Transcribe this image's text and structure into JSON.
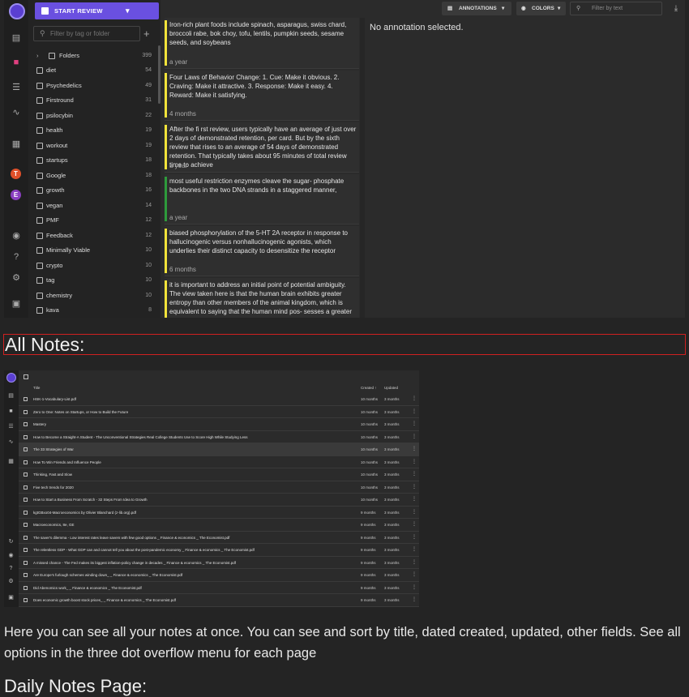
{
  "toolbar": {
    "start_review": "START REVIEW",
    "annotations": "ANNOTATIONS",
    "colors": "COLORS",
    "filter_placeholder": "Filter by text"
  },
  "tag_panel": {
    "filter_placeholder": "Filter by tag or folder",
    "folders": {
      "label": "Folders",
      "count": "399"
    },
    "tags": [
      {
        "label": "diet",
        "count": "54"
      },
      {
        "label": "Psychedelics",
        "count": "49"
      },
      {
        "label": "Firstround",
        "count": "31"
      },
      {
        "label": "psilocybin",
        "count": "22"
      },
      {
        "label": "health",
        "count": "19"
      },
      {
        "label": "workout",
        "count": "19"
      },
      {
        "label": "startups",
        "count": "18"
      },
      {
        "label": "Google",
        "count": "18"
      },
      {
        "label": "growth",
        "count": "16"
      },
      {
        "label": "vegan",
        "count": "14"
      },
      {
        "label": "PMF",
        "count": "12"
      },
      {
        "label": "Feedback",
        "count": "12"
      },
      {
        "label": "Minimally Viable",
        "count": "10"
      },
      {
        "label": "crypto",
        "count": "10"
      },
      {
        "label": "tag",
        "count": "10"
      },
      {
        "label": "chemistry",
        "count": "10"
      },
      {
        "label": "kava",
        "count": "8"
      }
    ]
  },
  "rail_avatars": [
    "T",
    "E"
  ],
  "annotations": [
    {
      "text": "Iron-rich plant foods include spinach, asparagus, swiss chard, broccoli rabe, bok choy, tofu, lentils, pumpkin seeds, sesame seeds, and soybeans",
      "age": "a year",
      "color": "#f2e33a"
    },
    {
      "text": "Four Laws of Behavior Change: 1. Cue: Make it obvious. 2. Craving: Make it attractive. 3. Response: Make it easy. 4. Reward: Make it satisfying.",
      "age": "4 months",
      "color": "#f2e33a"
    },
    {
      "text": "After the fi rst review, users typically have an average of just over 2 days of demonstrated retention, per card. But by the sixth review that rises to an average of 54 days of demonstrated retention. That typically takes about 95 minutes of total review time to achieve",
      "age": "a year",
      "color": "#f2e33a"
    },
    {
      "text": "most useful restriction enzymes cleave the sugar- phosphate backbones in the two DNA strands in a staggered manner,",
      "age": "a year",
      "color": "#2e9b3c"
    },
    {
      "text": "biased phosphorylation of the 5-HT 2A receptor in response to hallucinogenic versus nonhallucinogenic agonists, which underlies their distinct capacity to desensitize the receptor",
      "age": "6 months",
      "color": "#f2e33a"
    },
    {
      "text": "it is important to address an initial point of potential ambiguity. The view taken here is that the human brain exhibits greater entropy than other members of the animal kingdom, which is equivalent to saying that the human mind pos- sesses a greater repertoire of",
      "age": "",
      "color": "#f2e33a"
    }
  ],
  "detail": {
    "empty": "No annotation selected."
  },
  "section_heading": "All Notes:",
  "notes_table": {
    "columns": {
      "title": "Title",
      "created": "Created",
      "updated": "Updated"
    },
    "rows": [
      {
        "title": "HSK-1-Vocabulary-List.pdf",
        "created": "10 months",
        "updated": "3 months"
      },
      {
        "title": "Zero to One: Notes on Startups, or How to Build the Future",
        "created": "10 months",
        "updated": "3 months"
      },
      {
        "title": "Mastery",
        "created": "10 months",
        "updated": "3 months"
      },
      {
        "title": "How to Become a Straight-A Student - The Unconventional Strategies Real College Students Use to Score High While Studying Less",
        "created": "10 months",
        "updated": "3 months"
      },
      {
        "title": "The 33 Strategies of War",
        "created": "10 months",
        "updated": "3 months"
      },
      {
        "title": "How To Win Friends and Influence People",
        "created": "10 months",
        "updated": "3 months"
      },
      {
        "title": "Thinking, Fast and Slow",
        "created": "10 months",
        "updated": "3 months"
      },
      {
        "title": "Five tech trends for 2020",
        "created": "10 months",
        "updated": "3 months"
      },
      {
        "title": "How to Start a Business From Scratch - 32 Steps From Idea to Growth",
        "created": "10 months",
        "updated": "3 months"
      },
      {
        "title": "kgtGBxo04-Macroeconomics by Olivier Blanchard (z-lib.org).pdf",
        "created": "9 months",
        "updated": "3 months"
      },
      {
        "title": "Macroeconomics, 8e, GE",
        "created": "9 months",
        "updated": "3 months"
      },
      {
        "title": "The saver's dilemma - Low interest rates leave savers with few good options _ Finance & economics _ The Economist.pdf",
        "created": "9 months",
        "updated": "3 months"
      },
      {
        "title": "The relentless GDP - What GDP can and cannot tell you about the post-pandemic economy _ Finance & economics _ The Economist.pdf",
        "created": "9 months",
        "updated": "3 months"
      },
      {
        "title": "A missed chance - The Fed makes its biggest inflation-policy change in decades _ Finance & economics _ The Economist.pdf",
        "created": "9 months",
        "updated": "3 months"
      },
      {
        "title": "Are Europe's furlough schemes winding down_ _ Finance & economics _ The Economist.pdf",
        "created": "9 months",
        "updated": "3 months"
      },
      {
        "title": "Did Abenomics work_ _ Finance & economics _ The Economist.pdf",
        "created": "9 months",
        "updated": "3 months"
      },
      {
        "title": "Does economic growth boost stock prices_ _ Finance & economics _ The Economist.pdf",
        "created": "9 months",
        "updated": "3 months"
      }
    ]
  },
  "description": "Here you can see all your notes at once. You can see and sort by title, dated created, updated, other fields. See all options in the three dot overflow menu for each page",
  "next_heading": "Daily Notes Page:"
}
